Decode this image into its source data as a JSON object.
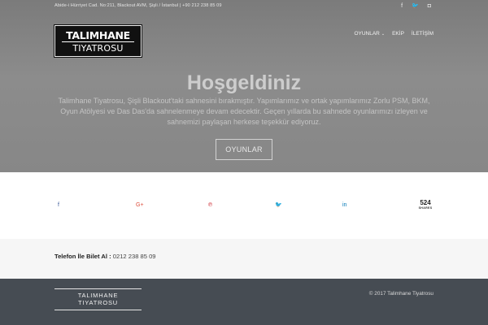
{
  "topbar": {
    "address": "Abide-i Hürriyet Cad. No:211, Blackout AVM, Şişli / İstanbul | +90 212 238 85 09",
    "social": [
      {
        "icon": "facebook-icon",
        "glyph": "f"
      },
      {
        "icon": "twitter-icon",
        "glyph": "🐦"
      },
      {
        "icon": "instagram-icon",
        "glyph": "◘"
      }
    ]
  },
  "logo": {
    "line1": "TALIMHANE",
    "line2": "TIYATROSU"
  },
  "nav": {
    "items": [
      {
        "label": "OYUNLAR",
        "caret": "⌄"
      },
      {
        "label": "EKİP"
      },
      {
        "label": "İLETİŞİM"
      }
    ]
  },
  "hero": {
    "title": "Hoşgeldiniz",
    "text": "Talimhane Tiyatrosu, Şişli Blackout'taki sahnesini bırakmıştır. Yapımlarımız ve ortak yapımlarımız Zorlu PSM, BKM, Oyun Atölyesi ve Das Das'da sahnelenmeye devam edecektir. Geçen yıllarda bu sahnede oyunlarımızı izleyen ve sahnemizi paylaşan herkese teşekkür ediyoruz.",
    "button": "OYUNLAR"
  },
  "share": {
    "icons": [
      {
        "name": "facebook-share-icon",
        "glyph": "f",
        "color": "#3b5998"
      },
      {
        "name": "google-plus-share-icon",
        "glyph": "G+",
        "color": "#dd4b39"
      },
      {
        "name": "pinterest-share-icon",
        "glyph": "℗",
        "color": "#cb2027"
      },
      {
        "name": "twitter-share-icon",
        "glyph": "🐦",
        "color": "#55acee"
      },
      {
        "name": "linkedin-share-icon",
        "glyph": "in",
        "color": "#0077b5"
      }
    ],
    "count": "524",
    "count_label": "SHARES"
  },
  "phone": {
    "label": "Telefon İle Bilet Al :",
    "number": "0212 238 85 09"
  },
  "footer": {
    "logo_line1": "TALIMHANE",
    "logo_line2": "TIYATROSU",
    "copyright": "© 2017 Talimhane Tiyatrosu"
  }
}
